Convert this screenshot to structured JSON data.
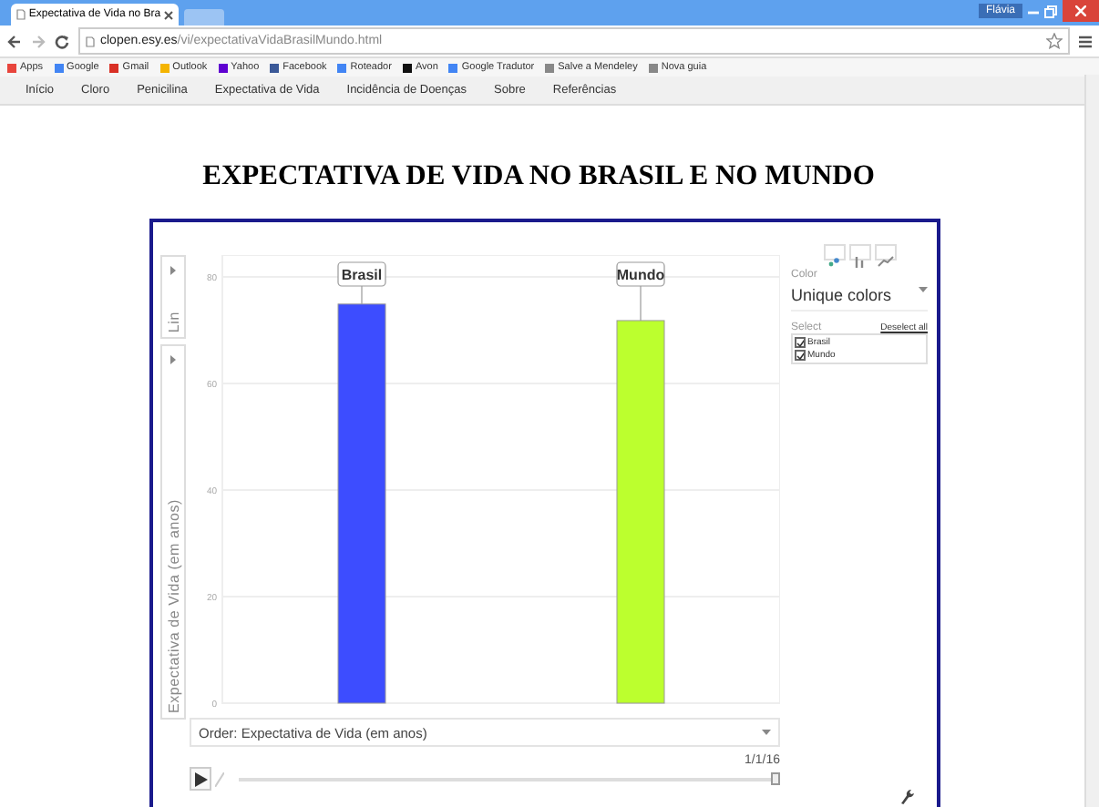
{
  "browser": {
    "tab_title": "Expectativa de Vida no Bra",
    "user": "Flávia",
    "address_host": "clopen.esy.es",
    "address_path": "/vi/expectativaVidaBrasilMundo.html",
    "bookmarks": [
      {
        "label": "Apps",
        "color": "#e8453c"
      },
      {
        "label": "Google",
        "color": "#4285f4"
      },
      {
        "label": "Gmail",
        "color": "#d93025"
      },
      {
        "label": "Outlook",
        "color": "#f4b400"
      },
      {
        "label": "Yahoo",
        "color": "#5f01d1"
      },
      {
        "label": "Facebook",
        "color": "#3b5998"
      },
      {
        "label": "Roteador",
        "color": "#4285f4"
      },
      {
        "label": "Avon",
        "color": "#111111"
      },
      {
        "label": "Google Tradutor",
        "color": "#4285f4"
      },
      {
        "label": "Salve a Mendeley",
        "color": "#888888"
      },
      {
        "label": "Nova guia",
        "color": "#888888"
      }
    ]
  },
  "nav": [
    "Início",
    "Cloro",
    "Penicilina",
    "Expectativa de Vida",
    "Incidência de Doenças",
    "Sobre",
    "Referências"
  ],
  "page_title": "EXPECTATIVA DE VIDA NO BRASIL E NO MUNDO",
  "motion_chart": {
    "y_scale": "Lin",
    "time_slider": {
      "level": 1
    },
    "chart_data": {
      "type": "bar",
      "ylabel": "Expectativa de Vida (em anos)",
      "grid": true,
      "ylim": [
        0,
        80
      ],
      "yticks": [
        0,
        20,
        40,
        60,
        80
      ],
      "series": [
        {
          "name": "Brasil",
          "color": "#3d4dff",
          "values": [
            74.9,
            null
          ]
        },
        {
          "name": "Mundo",
          "color": "#bcff2e",
          "values": [
            null,
            71.8
          ]
        }
      ]
    },
    "color_label": "Color",
    "color_value": "Unique colors",
    "select_label": "Select",
    "deselect": "Deselect all",
    "items": [
      {
        "label": "Brasil",
        "checked": true
      },
      {
        "label": "Mundo",
        "checked": true
      }
    ],
    "order": "Order: Expectativa de Vida (em anos)",
    "date": "1/1/16"
  }
}
